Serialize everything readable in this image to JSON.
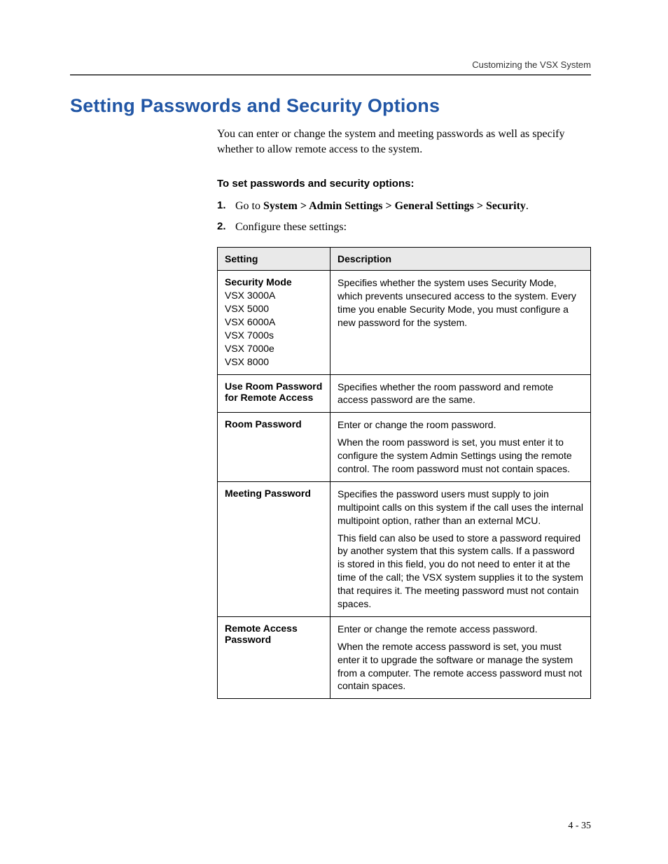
{
  "header": {
    "running_head": "Customizing the VSX System"
  },
  "section": {
    "title": "Setting Passwords and Security Options",
    "intro": "You can enter or change the system and meeting passwords as well as specify whether to allow remote access to the system.",
    "subhead": "To set passwords and security options:",
    "steps": {
      "s1_pre": "Go to ",
      "s1_path": "System > Admin Settings > General Settings > Security",
      "s1_post": ".",
      "s2": "Configure these settings:"
    }
  },
  "table": {
    "col1": "Setting",
    "col2": "Description",
    "rows": [
      {
        "setting": "Security Mode",
        "setting_sub": [
          "VSX 3000A",
          "VSX 5000",
          "VSX 6000A",
          "VSX 7000s",
          "VSX 7000e",
          "VSX 8000"
        ],
        "desc": [
          "Specifies whether the system uses Security Mode, which prevents unsecured access to the system. Every time you enable Security Mode, you must configure a new password for the system."
        ]
      },
      {
        "setting": "Use Room Password for Remote Access",
        "setting_sub": [],
        "desc": [
          "Specifies whether the room password and remote access password are the same."
        ]
      },
      {
        "setting": "Room Password",
        "setting_sub": [],
        "desc": [
          "Enter or change the room password.",
          "When the room password is set, you must enter it to configure the system Admin Settings using the remote control. The room password must not contain spaces."
        ]
      },
      {
        "setting": "Meeting Password",
        "setting_sub": [],
        "desc": [
          "Specifies the password users must supply to join multipoint calls on this system if the call uses the internal multipoint option, rather than an external MCU.",
          "This field can also be used to store a password required by another system that this system calls. If a password is stored in this field, you do not need to enter it at the time of the call; the VSX system supplies it to the system that requires it. The meeting password must not contain spaces."
        ]
      },
      {
        "setting": "Remote Access Password",
        "setting_sub": [],
        "desc": [
          "Enter or change the remote access password.",
          "When the remote access password is set, you must enter it to upgrade the software or manage the system from a computer. The remote access password must not contain spaces."
        ]
      }
    ]
  },
  "footer": {
    "page_number": "4 - 35"
  }
}
